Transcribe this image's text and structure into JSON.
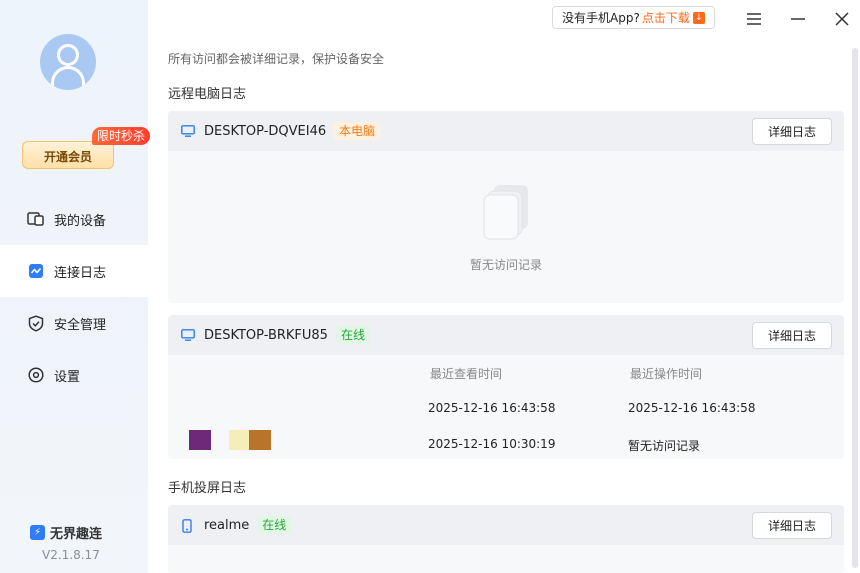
{
  "app": {
    "brand_name": "无界趣连",
    "version": "V2.1.8.17"
  },
  "topbar": {
    "download_prompt": "没有手机App?",
    "download_link": "点击下载"
  },
  "sidebar": {
    "vip_button": "开通会员",
    "flash_badge": "限时秒杀",
    "items": [
      {
        "label": "我的设备",
        "icon": "devices-icon"
      },
      {
        "label": "连接日志",
        "icon": "log-icon",
        "active": true
      },
      {
        "label": "安全管理",
        "icon": "shield-icon"
      },
      {
        "label": "设置",
        "icon": "settings-icon"
      }
    ]
  },
  "main": {
    "subtitle": "所有访问都会被详细记录，保护设备安全",
    "remote_section_title": "远程电脑日志",
    "phone_section_title": "手机投屏日志",
    "detail_button": "详细日志",
    "devices": [
      {
        "name": "DESKTOP-DQVEI46",
        "tag": "本电脑",
        "empty_text": "暂无访问记录"
      },
      {
        "name": "DESKTOP-BRKFU85",
        "tag": "在线",
        "columns": [
          "最近查看时间",
          "最近操作时间"
        ],
        "rows": [
          [
            "2025-12-16 16:43:58",
            "2025-12-16 16:43:58"
          ],
          [
            "2025-12-16 10:30:19",
            "暂无访问记录"
          ]
        ]
      },
      {
        "name": "realme",
        "tag": "在线"
      }
    ]
  },
  "colors": {
    "accent": "#2f7cf6",
    "online": "#27a63b",
    "orange": "#ff6a1a"
  }
}
